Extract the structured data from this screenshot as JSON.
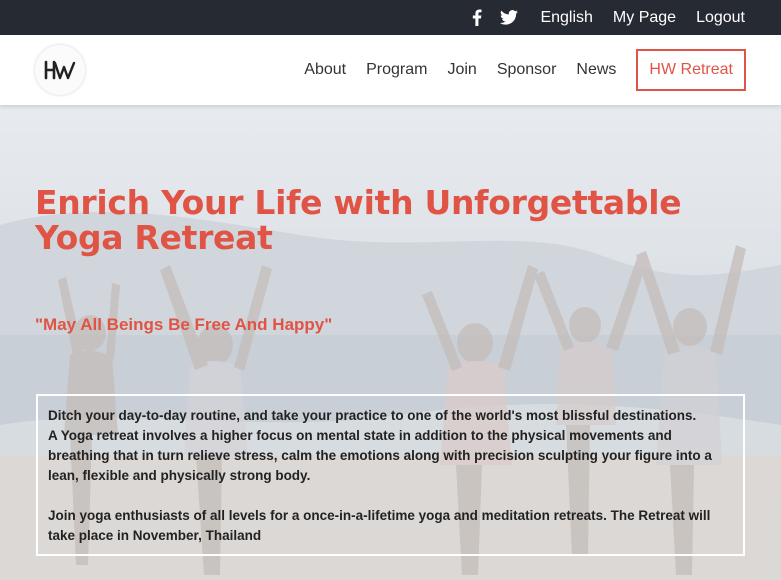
{
  "topbar": {
    "icons": [
      "facebook-icon",
      "twitter-icon"
    ],
    "links": [
      "English",
      "My Page",
      "Logout"
    ]
  },
  "navbar": {
    "logo_text": "HW",
    "items": [
      "About",
      "Program",
      "Join",
      "Sponsor",
      "News"
    ],
    "cta": "HW Retreat"
  },
  "hero": {
    "title": "Enrich Your Life with Unforgettable Yoga Retreat",
    "quote": "\"May All Beings Be Free And Happy\"",
    "paragraph1_lines": [
      "Ditch your day-to-day routine, and take your practice to one of the world's most blissful destinations.",
      "A Yoga retreat involves a higher focus on mental state in addition to the physical movements and breathing that in turn relieve stress, calm the emotions along with precision sculpting your figure into a lean, flexible and physically strong body."
    ],
    "paragraph2": "Join yoga enthusiasts of all levels for a once-in-a-lifetime yoga and meditation retreats. The Retreat will take place in November, Thailand"
  },
  "colors": {
    "accent": "#e05445",
    "topbar_bg": "#262a33"
  }
}
